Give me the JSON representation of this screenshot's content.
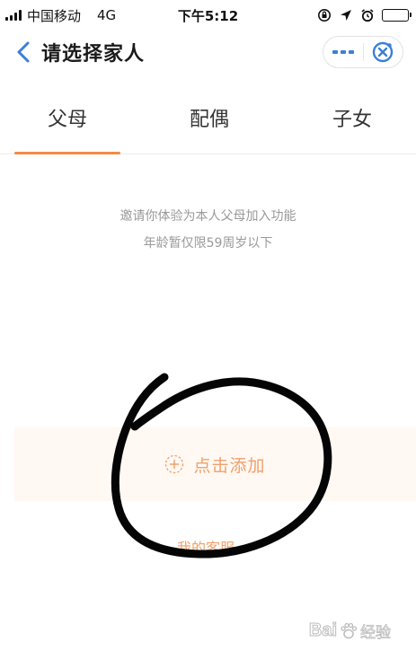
{
  "status_bar": {
    "carrier": "中国移动",
    "network": "4G",
    "time": "下午5:12",
    "battery_level": 0.55,
    "icons": [
      "rotation-lock-icon",
      "location-icon",
      "alarm-icon",
      "battery-icon"
    ]
  },
  "nav": {
    "title": "请选择家人",
    "back_icon": "chevron-left-icon",
    "more_icon": "more-dots-icon",
    "close_icon": "close-circle-icon",
    "accent": "#3b7fd9"
  },
  "tabs": [
    {
      "label": "父母",
      "active": true
    },
    {
      "label": "配偶",
      "active": false
    },
    {
      "label": "子女",
      "active": false
    }
  ],
  "tab_accent": "#f58a45",
  "info": {
    "line1": "邀请你体验为本人父母加入功能",
    "line2": "年龄暂仅限59周岁以下"
  },
  "add": {
    "label": "点击添加",
    "icon": "plus-circle-dashed-icon",
    "color": "#f0a06a"
  },
  "service": {
    "label": "我的客服"
  },
  "watermark": {
    "text": "Bai",
    "suffix": "经验"
  }
}
